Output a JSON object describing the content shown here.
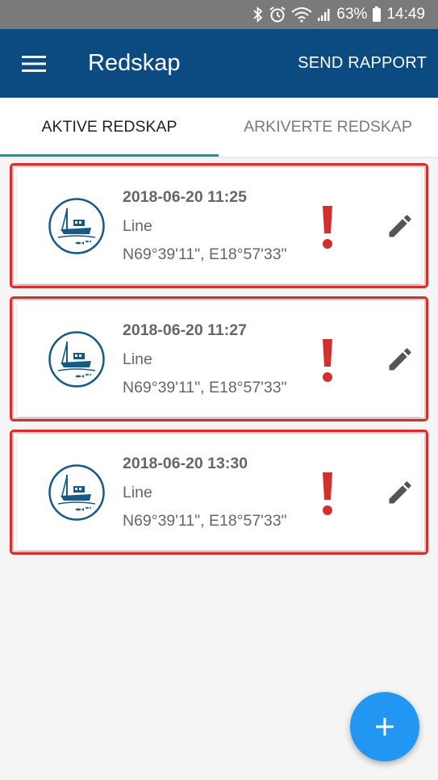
{
  "status_bar": {
    "battery": "63%",
    "time": "14:49",
    "icons": [
      "bluetooth-icon",
      "alarm-icon",
      "wifi-icon",
      "signal-icon",
      "battery-icon"
    ]
  },
  "app_bar": {
    "title": "Redskap",
    "action": "SEND RAPPORT",
    "color": "#0c4b81"
  },
  "tabs": [
    {
      "label": "AKTIVE REDSKAP",
      "active": true
    },
    {
      "label": "ARKIVERTE REDSKAP",
      "active": false
    }
  ],
  "cards": [
    {
      "date": "2018-06-20 11:25",
      "type": "Line",
      "position": "N69°39'11\", E18°57'33\"",
      "icon": "fishing-boat-icon",
      "alert": true
    },
    {
      "date": "2018-06-20 11:27",
      "type": "Line",
      "position": "N69°39'11\", E18°57'33\"",
      "icon": "fishing-boat-icon",
      "alert": true
    },
    {
      "date": "2018-06-20 13:30",
      "type": "Line",
      "position": "N69°39'11\", E18°57'33\"",
      "icon": "fishing-boat-icon",
      "alert": true
    }
  ],
  "colors": {
    "alert": "#d32f2f",
    "tab_indicator": "#1a9a97",
    "fab": "#2196f3"
  },
  "fab": {
    "label": "+"
  }
}
